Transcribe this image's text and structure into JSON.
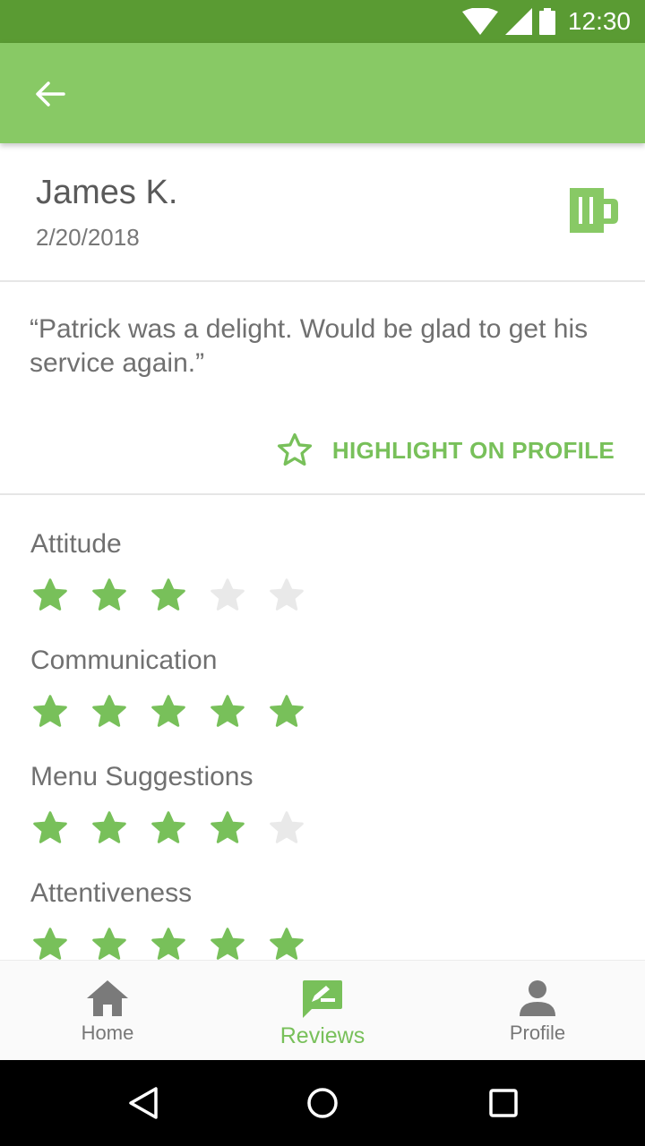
{
  "status_bar": {
    "time": "12:30"
  },
  "app_bar": {
    "back_icon": "arrow-back-icon"
  },
  "review": {
    "reviewer_name": "James K.",
    "date": "2/20/2018",
    "comment": "“Patrick was a delight. Would be glad to get his service again.”",
    "highlight_label": "HIGHLIGHT ON PROFILE"
  },
  "ratings": [
    {
      "label": "Attitude",
      "score": 3,
      "max": 5
    },
    {
      "label": "Communication",
      "score": 5,
      "max": 5
    },
    {
      "label": "Menu Suggestions",
      "score": 4,
      "max": 5
    },
    {
      "label": "Attentiveness",
      "score": 5,
      "max": 5
    }
  ],
  "bottom_nav": {
    "items": [
      {
        "label": "Home",
        "icon": "home-icon"
      },
      {
        "label": "Reviews",
        "icon": "reviews-icon"
      },
      {
        "label": "Profile",
        "icon": "profile-icon"
      }
    ],
    "active": "Reviews"
  },
  "colors": {
    "status_bar": "#5a9b33",
    "app_bar": "#88c965",
    "accent": "#78c05a",
    "star_empty": "#e9e9e9"
  }
}
